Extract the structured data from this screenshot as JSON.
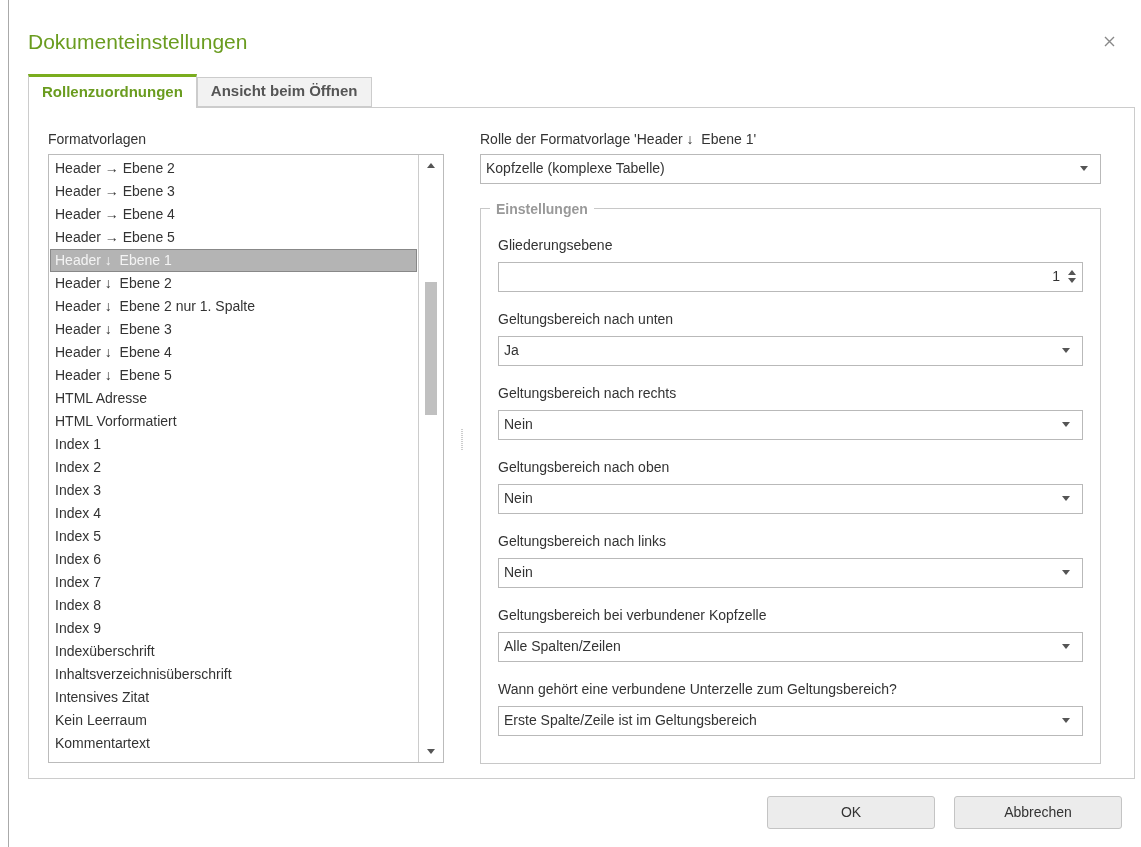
{
  "window": {
    "title": "Dokumenteinstellungen"
  },
  "tabs": [
    {
      "label": "Rollenzuordnungen",
      "selected": true
    },
    {
      "label": "Ansicht beim Öffnen",
      "selected": false
    }
  ],
  "styles": {
    "label": "Formatvorlagen",
    "items": [
      {
        "label": "Header → Ebene 2",
        "selected": false
      },
      {
        "label": "Header → Ebene 3",
        "selected": false
      },
      {
        "label": "Header → Ebene 4",
        "selected": false
      },
      {
        "label": "Header → Ebene 5",
        "selected": false
      },
      {
        "label": "Header ↓  Ebene 1",
        "selected": true
      },
      {
        "label": "Header ↓  Ebene 2",
        "selected": false
      },
      {
        "label": "Header ↓  Ebene 2 nur 1. Spalte",
        "selected": false
      },
      {
        "label": "Header ↓  Ebene 3",
        "selected": false
      },
      {
        "label": "Header ↓  Ebene 4",
        "selected": false
      },
      {
        "label": "Header ↓  Ebene 5",
        "selected": false
      },
      {
        "label": "HTML Adresse",
        "selected": false
      },
      {
        "label": "HTML Vorformatiert",
        "selected": false
      },
      {
        "label": "Index 1",
        "selected": false
      },
      {
        "label": "Index 2",
        "selected": false
      },
      {
        "label": "Index 3",
        "selected": false
      },
      {
        "label": "Index 4",
        "selected": false
      },
      {
        "label": "Index 5",
        "selected": false
      },
      {
        "label": "Index 6",
        "selected": false
      },
      {
        "label": "Index 7",
        "selected": false
      },
      {
        "label": "Index 8",
        "selected": false
      },
      {
        "label": "Index 9",
        "selected": false
      },
      {
        "label": "Indexüberschrift",
        "selected": false
      },
      {
        "label": "Inhaltsverzeichnisüberschrift",
        "selected": false
      },
      {
        "label": "Intensives Zitat",
        "selected": false
      },
      {
        "label": "Kein Leerraum",
        "selected": false
      },
      {
        "label": "Kommentartext",
        "selected": false
      }
    ]
  },
  "role": {
    "label": "Rolle der Formatvorlage 'Header ↓  Ebene 1'",
    "value": "Kopfzelle (komplexe Tabelle)"
  },
  "settings": {
    "title": "Einstellungen",
    "fields": [
      {
        "kind": "spin",
        "label": "Gliederungsebene",
        "value": "1"
      },
      {
        "kind": "select",
        "label": "Geltungsbereich nach unten",
        "value": "Ja"
      },
      {
        "kind": "select",
        "label": "Geltungsbereich nach rechts",
        "value": "Nein"
      },
      {
        "kind": "select",
        "label": "Geltungsbereich nach oben",
        "value": "Nein"
      },
      {
        "kind": "select",
        "label": "Geltungsbereich nach links",
        "value": "Nein"
      },
      {
        "kind": "select",
        "label": "Geltungsbereich bei verbundener Kopfzelle",
        "value": "Alle Spalten/Zeilen"
      },
      {
        "kind": "select",
        "label": "Wann gehört eine verbundene Unterzelle zum Geltungsbereich?",
        "value": "Erste Spalte/Zeile ist im Geltungsbereich"
      }
    ]
  },
  "buttons": [
    "OK",
    "Abbrechen"
  ]
}
